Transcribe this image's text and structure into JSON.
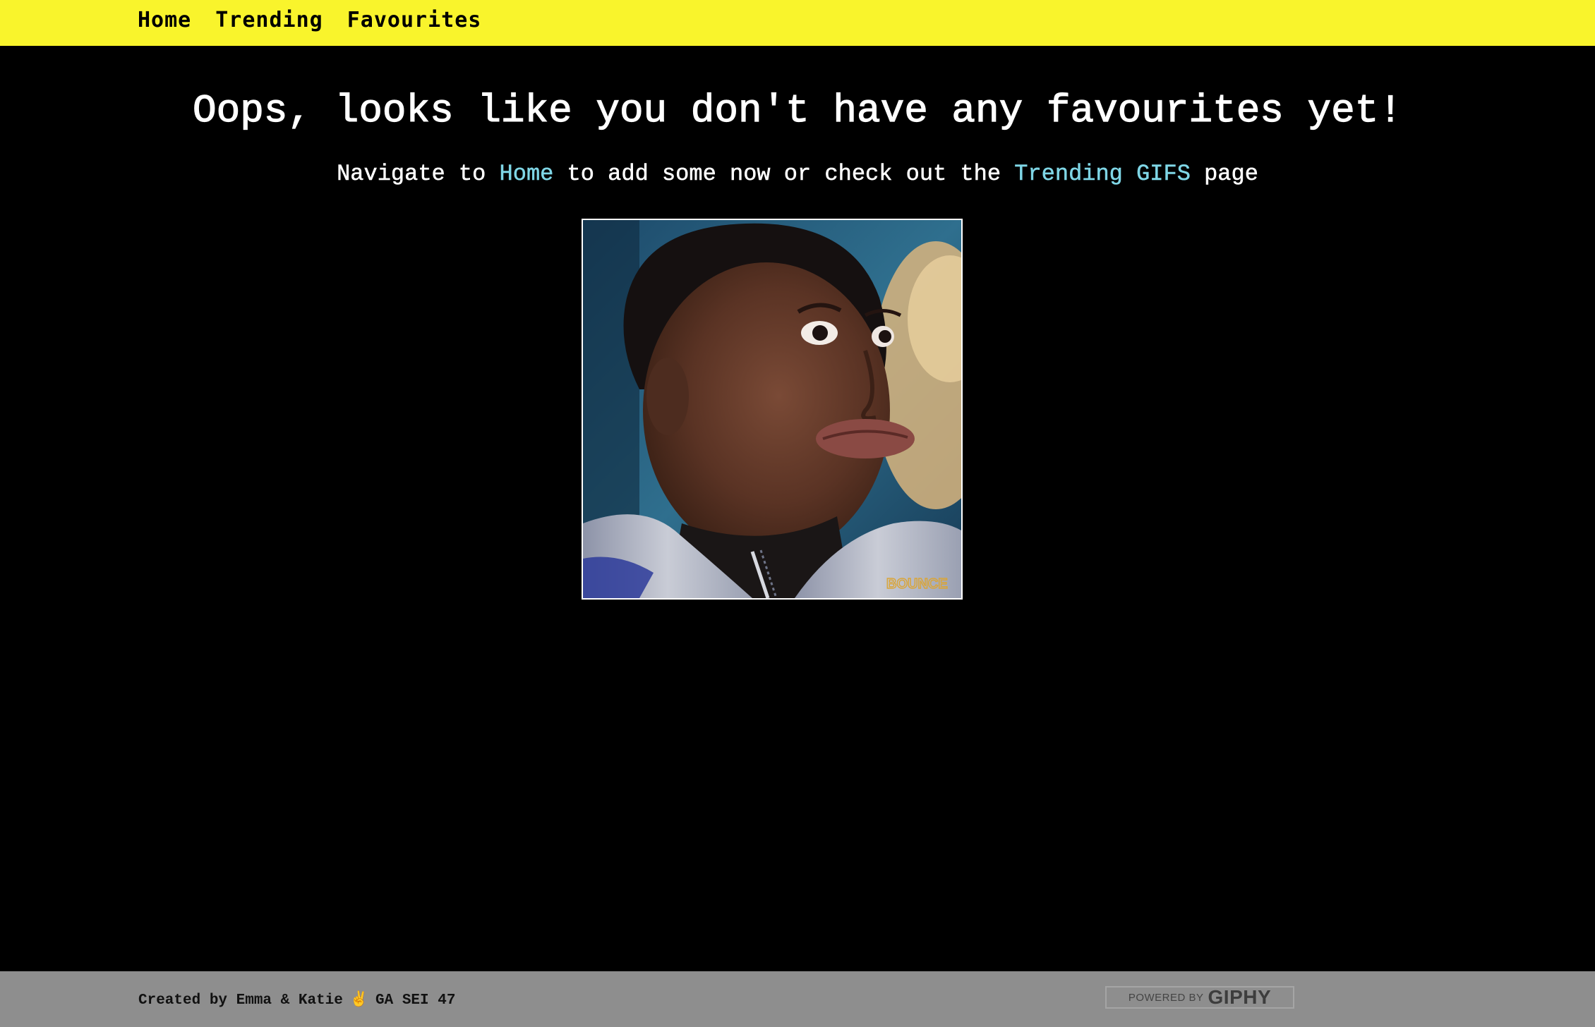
{
  "nav": {
    "items": [
      {
        "label": "Home"
      },
      {
        "label": "Trending"
      },
      {
        "label": "Favourites"
      }
    ]
  },
  "main": {
    "headline": "Oops, looks like you don't have any favourites yet!",
    "subline": {
      "prefix": "Navigate to ",
      "home_link": "Home",
      "middle": " to add some now or check out the ",
      "trending_link": "Trending GIFS",
      "suffix": " page"
    },
    "gif": {
      "watermark": "BOUNCE"
    }
  },
  "footer": {
    "credits_left": "Created by Emma & Katie",
    "credits_emoji": "✌️",
    "credits_right": "GA SEI 47",
    "giphy_powered": "POWERED BY",
    "giphy_logo": "GIPHY"
  },
  "colors": {
    "nav_bg": "#f9f42c",
    "page_bg": "#000000",
    "link": "#7fd6e6",
    "footer_bg": "#8e8e8e"
  }
}
